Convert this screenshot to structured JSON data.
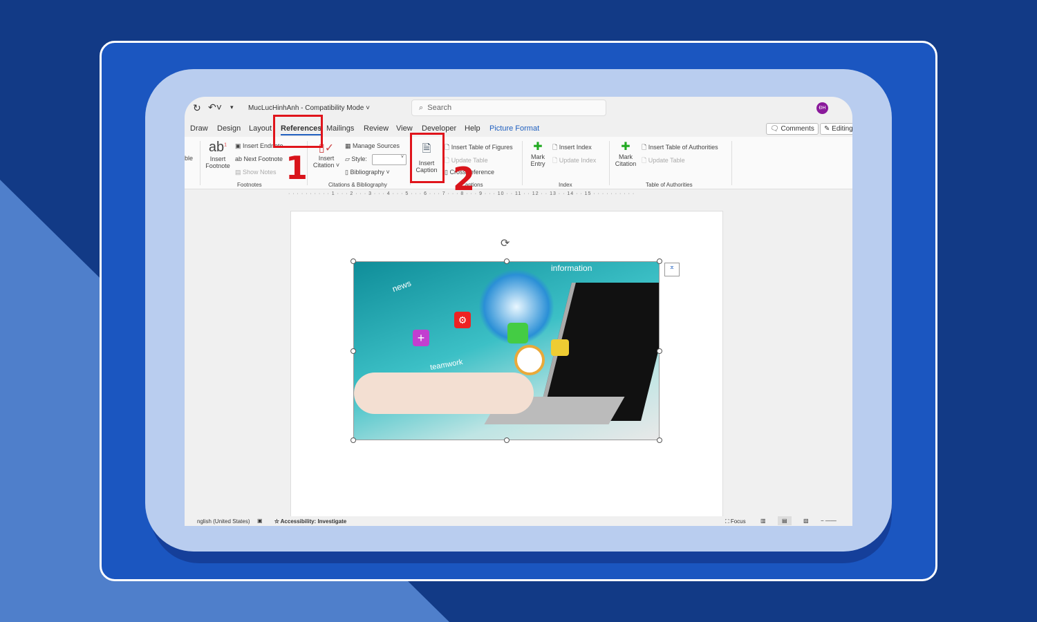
{
  "title": {
    "doc": "MucLucHinhAnh",
    "mode": "Compatibility Mode"
  },
  "search": {
    "placeholder": "Search"
  },
  "avatar": "ĐH",
  "tabs": [
    "Draw",
    "Design",
    "Layout",
    "References",
    "Mailings",
    "Review",
    "View",
    "Developer",
    "Help",
    "Picture Format"
  ],
  "active_tab": "References",
  "buttons": {
    "comments": "Comments",
    "editing": "Editing"
  },
  "ribbon": {
    "cut_label": "ble",
    "footnotes": {
      "insert": [
        "Insert",
        "Footnote"
      ],
      "endnote": "Insert Endnote",
      "next": "Next Footnote",
      "show": "Show Notes",
      "group": "Footnotes"
    },
    "citations": {
      "insert": [
        "Insert",
        "Citation"
      ],
      "manage": "Manage Sources",
      "style": "Style:",
      "bibliography": "Bibliography",
      "group": "Citations & Bibliography"
    },
    "captions": {
      "insert": [
        "Insert",
        "Caption"
      ],
      "tof": "Insert Table of Figures",
      "update": "Update Table",
      "cross": "Cross-reference",
      "group": "Captions"
    },
    "index": {
      "mark": [
        "Mark",
        "Entry"
      ],
      "insert": "Insert Index",
      "update": "Update Index",
      "group": "Index"
    },
    "toa": {
      "mark": [
        "Mark",
        "Citation"
      ],
      "insert": "Insert Table of Authorities",
      "update": "Update Table",
      "group": "Table of Authorities"
    }
  },
  "ruler": "· · · · · · · · · · 1 · · · 2 · · · 3 · · · 4 · · · 5 · · · 6 · · · 7 · · · 8 · · · 9 · · · 10 · · 11 · · 12 · · 13 · · 14 · · 15 · · · · · · · · · ·",
  "steps": [
    "1",
    "2"
  ],
  "image_text": {
    "info": "information",
    "news": "news",
    "team": "teamwork"
  },
  "status": {
    "language": "nglish (United States)",
    "accessibility": "Accessibility: Investigate",
    "focus": "Focus"
  },
  "colors": {
    "accent": "#1f5fbf",
    "highlight": "#e0141b",
    "avatar": "#8a1a9b"
  }
}
